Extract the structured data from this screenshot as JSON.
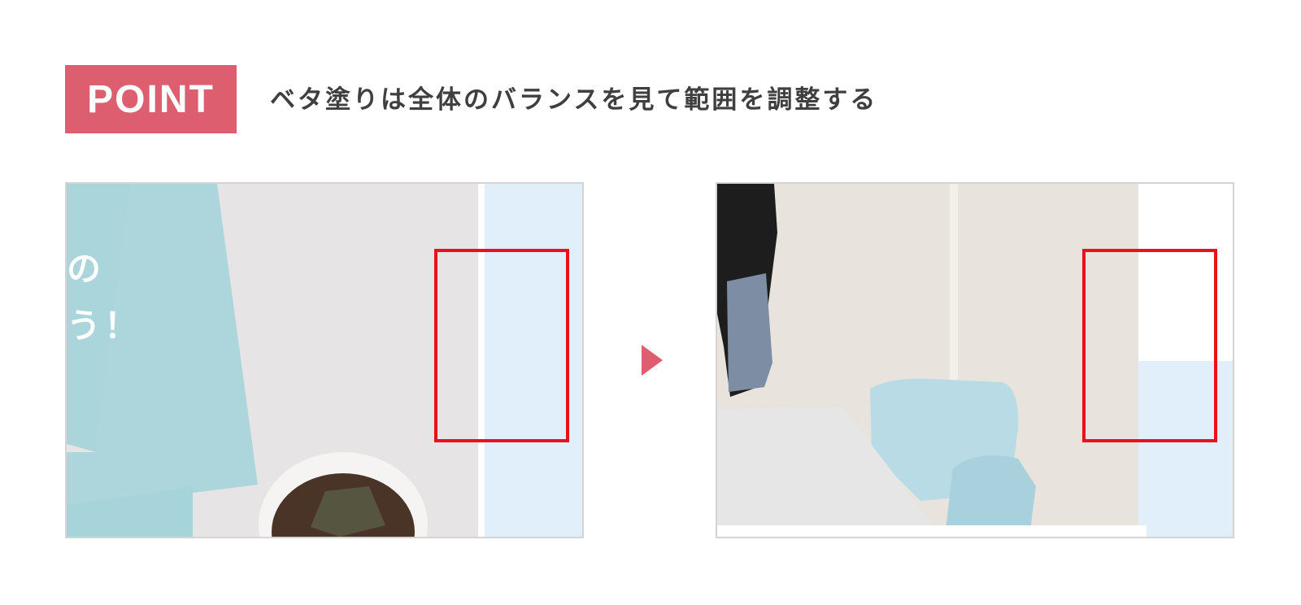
{
  "badge": {
    "label": "POINT"
  },
  "headline": {
    "text": "ベタ塗りは全体のバランスを見て範囲を調整する"
  },
  "left_panel": {
    "text_line1": "の",
    "text_line2": "う！"
  },
  "colors": {
    "accent": "#dd5e6f",
    "highlight": "#e8121b",
    "fill_light_blue": "#e1effb",
    "paper_teal": "#a9d5db",
    "table_gray": "#e9e9e9"
  }
}
